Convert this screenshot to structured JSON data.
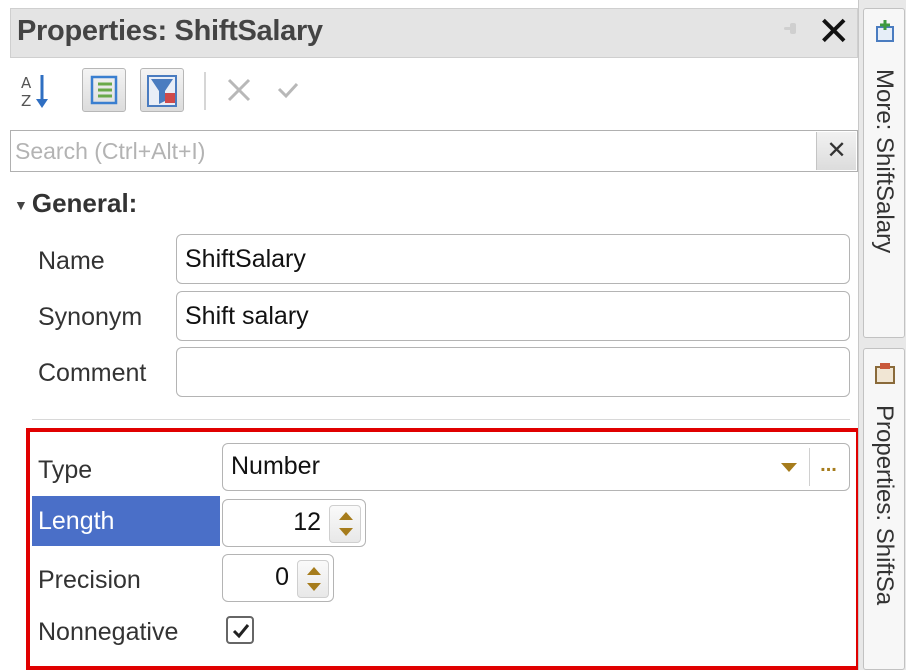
{
  "panel": {
    "title": "Properties: ShiftSalary"
  },
  "toolbar": {
    "buttons": [
      {
        "icon": "sort-alphabetical-icon"
      },
      {
        "icon": "categorized-view-icon"
      },
      {
        "icon": "filter-icon"
      },
      {
        "icon": "delete-icon"
      },
      {
        "icon": "check-icon"
      }
    ]
  },
  "search": {
    "placeholder": "Search (Ctrl+Alt+I)",
    "value": ""
  },
  "general": {
    "header": "General:",
    "fields": {
      "name": {
        "label": "Name",
        "value": "ShiftSalary"
      },
      "synonym": {
        "label": "Synonym",
        "value": "Shift salary"
      },
      "comment": {
        "label": "Comment",
        "value": ""
      }
    }
  },
  "type_section": {
    "type": {
      "label": "Type",
      "value": "Number",
      "more": "..."
    },
    "length": {
      "label": "Length",
      "value": "12"
    },
    "precision": {
      "label": "Precision",
      "value": "0"
    },
    "nonnegative": {
      "label": "Nonnegative",
      "checked": true
    }
  },
  "dock": {
    "tabs": [
      {
        "label": "More: ShiftSalary",
        "icon": "add-object-icon"
      },
      {
        "label": "Properties: ShiftSa",
        "icon": "properties-icon"
      }
    ]
  },
  "colors": {
    "highlight_border": "#e00000",
    "selected_row": "#4a6fc8",
    "accent": "#a67c1c"
  }
}
